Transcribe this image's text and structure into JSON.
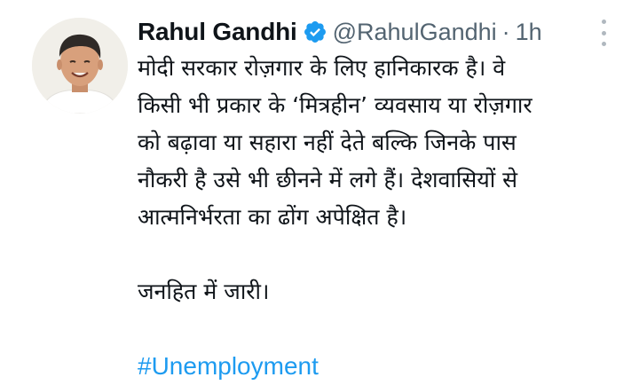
{
  "author": {
    "display_name": "Rahul Gandhi",
    "handle": "@RahulGandhi",
    "separator": "·",
    "timestamp": "1h",
    "verified_icon": "verified-badge-icon",
    "avatar_icon": "profile-photo"
  },
  "tweet": {
    "lines": [
      "मोदी सरकार रोज़गार के लिए हानिकारक है। वे",
      "किसी भी प्रकार के ‘मित्रहीन’ व्यवसाय या रोज़गार",
      "को बढ़ावा या सहारा नहीं देते बल्कि जिनके पास",
      "नौकरी है उसे भी छीनने में लगे हैं। देशवासियों से",
      "आत्मनिर्भरता का ढोंग अपेक्षित है।"
    ],
    "second_paragraph": "जनहित में जारी।",
    "hashtag": "#Unemployment"
  },
  "menu": {
    "icon": "more-options-icon"
  },
  "colors": {
    "text": "#0f1419",
    "secondary": "#536471",
    "link": "#1d9bf0",
    "verified": "#1d9bf0"
  }
}
